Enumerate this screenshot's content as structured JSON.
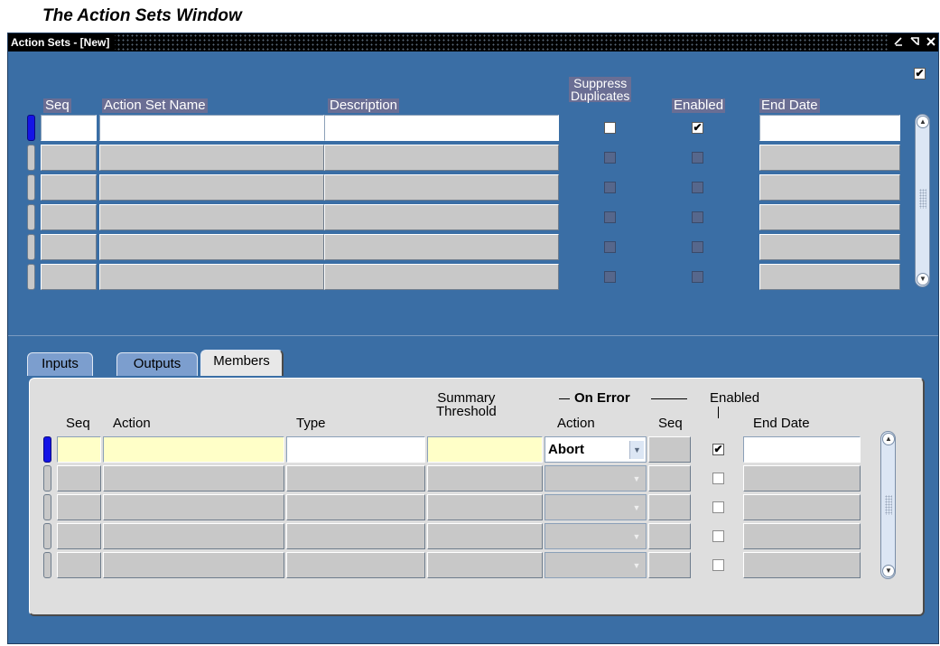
{
  "caption": "The Action Sets Window",
  "window": {
    "title": "Action Sets - [New]",
    "controls": {
      "minimize": "⯆",
      "maximize": "⬚",
      "close": "✕"
    }
  },
  "top_form": {
    "headers": {
      "seq": "Seq",
      "name": "Action Set Name",
      "description": "Description",
      "suppress_1": "Suppress",
      "suppress_2": "Duplicates",
      "enabled": "Enabled",
      "end_date": "End Date"
    },
    "corner_checkbox": "checked",
    "rows": [
      {
        "active": true,
        "suppress": "unchecked",
        "enabled": "checked"
      },
      {
        "active": false,
        "suppress": "disabled",
        "enabled": "disabled"
      },
      {
        "active": false,
        "suppress": "disabled",
        "enabled": "disabled"
      },
      {
        "active": false,
        "suppress": "disabled",
        "enabled": "disabled"
      },
      {
        "active": false,
        "suppress": "disabled",
        "enabled": "disabled"
      },
      {
        "active": false,
        "suppress": "disabled",
        "enabled": "disabled"
      }
    ]
  },
  "tabs": [
    {
      "label": "Inputs",
      "active": false
    },
    {
      "label": "Outputs",
      "active": false
    },
    {
      "label": "Members",
      "active": true
    }
  ],
  "members": {
    "headers": {
      "seq": "Seq",
      "action": "Action",
      "type": "Type",
      "summary_1": "Summary",
      "summary_2": "Threshold",
      "on_error": "On Error",
      "err_action": "Action",
      "err_seq": "Seq",
      "enabled": "Enabled",
      "end_date": "End Date"
    },
    "rows": [
      {
        "active": true,
        "on_error_action": "Abort",
        "enabled": "checked"
      },
      {
        "active": false,
        "on_error_action": "",
        "enabled": "unchecked"
      },
      {
        "active": false,
        "on_error_action": "",
        "enabled": "unchecked"
      },
      {
        "active": false,
        "on_error_action": "",
        "enabled": "unchecked"
      },
      {
        "active": false,
        "on_error_action": "",
        "enabled": "unchecked"
      }
    ]
  },
  "colors": {
    "window_bg": "#3a6ea5",
    "active_row": "#1414e6",
    "required_field": "#ffffc8",
    "tab_inactive": "#7c9ece"
  }
}
